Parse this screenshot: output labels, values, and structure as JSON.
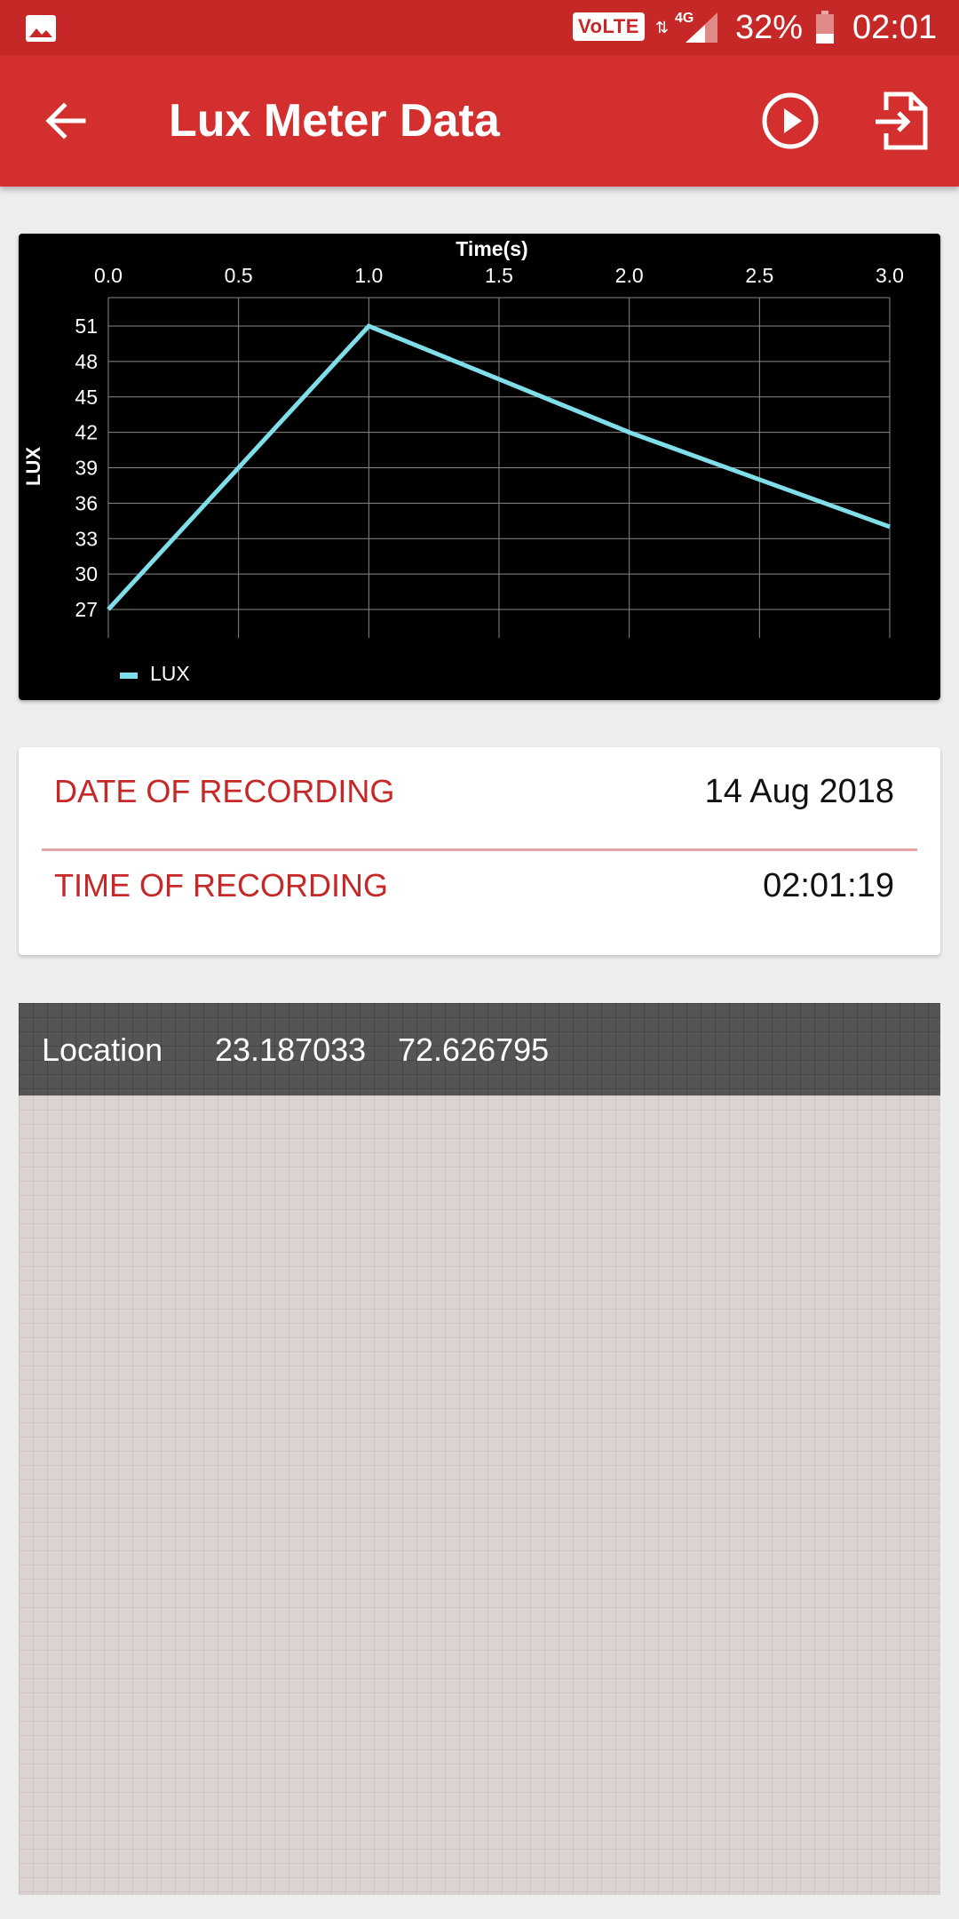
{
  "status_bar": {
    "volte": "VoLTE",
    "network": "4G",
    "battery": "32%",
    "time": "02:01"
  },
  "app_bar": {
    "title": "Lux Meter Data",
    "icons": [
      "arrow-back-icon",
      "play-circle-icon",
      "export-icon"
    ]
  },
  "recording": {
    "date_label": "DATE OF RECORDING",
    "date_value": "14 Aug 2018",
    "time_label": "TIME OF RECORDING",
    "time_value": "02:01:19"
  },
  "location": {
    "label": "Location",
    "latitude": "23.187033",
    "longitude": "72.626795"
  },
  "colors": {
    "primary": "#d32f2f",
    "status_bar": "#c62828",
    "series": "#80deea"
  },
  "chart_data": {
    "type": "line",
    "xlabel": "Time(s)",
    "ylabel": "LUX",
    "x_ticks": [
      "0.0",
      "0.5",
      "1.0",
      "1.5",
      "2.0",
      "2.5",
      "3.0"
    ],
    "y_ticks": [
      "51",
      "48",
      "45",
      "42",
      "39",
      "36",
      "33",
      "30",
      "27"
    ],
    "xlim": [
      0,
      3
    ],
    "ylim": [
      27,
      51
    ],
    "grid": true,
    "legend_position": "bottom-left",
    "series": [
      {
        "name": "LUX",
        "x": [
          0,
          1,
          2,
          3
        ],
        "y": [
          27,
          51,
          42,
          34
        ]
      }
    ]
  }
}
